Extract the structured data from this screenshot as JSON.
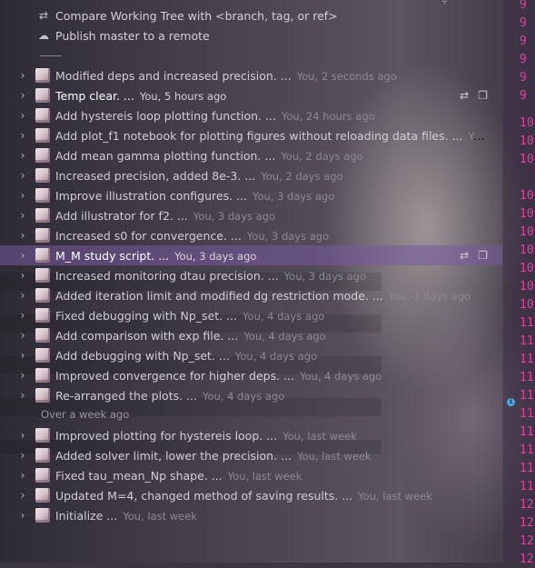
{
  "commands": [
    {
      "icon": "compare-icon",
      "glyph": "⇄",
      "label": "Compare Working Tree with <branch, tag, or ref>"
    },
    {
      "icon": "cloud-upload-icon",
      "glyph": "☁",
      "label": "Publish master to a remote"
    }
  ],
  "commits": [
    {
      "message": "Modified deps and increased precision. ...",
      "meta": "You, 2 seconds ago"
    },
    {
      "message": "Temp clear. ...",
      "meta": "You, 5 hours ago"
    },
    {
      "message": "Add hystereis loop plotting function. ...",
      "meta": "You, 24 hours ago"
    },
    {
      "message": "Add plot_f1 notebook for plotting figures without reloading data files. ...",
      "meta": "You, yest..."
    },
    {
      "message": "Add mean gamma plotting function. ...",
      "meta": "You, 2 days ago"
    },
    {
      "message": "Increased precision, added 8e-3. ...",
      "meta": "You, 2 days ago"
    },
    {
      "message": "Improve illustration configures. ...",
      "meta": "You, 3 days ago"
    },
    {
      "message": "Add illustrator for f2. ...",
      "meta": "You, 3 days ago"
    },
    {
      "message": "Increased s0 for convergence. ...",
      "meta": "You, 3 days ago"
    },
    {
      "message": "M_M study script. ...",
      "meta": "You, 3 days ago"
    },
    {
      "message": "Increased monitoring dtau precision. ...",
      "meta": "You, 3 days ago"
    },
    {
      "message": "Added iteration limit and modified dg restriction mode. ...",
      "meta": "You, 3 days ago"
    },
    {
      "message": "Fixed debugging with Np_set. ...",
      "meta": "You, 4 days ago"
    },
    {
      "message": "Add comparison with exp file. ...",
      "meta": "You, 4 days ago"
    },
    {
      "message": "Add debugging with Np_set. ...",
      "meta": "You, 4 days ago"
    },
    {
      "message": "Improved convergence for higher deps. ...",
      "meta": "You, 4 days ago"
    },
    {
      "message": "Re-arranged the plots. ...",
      "meta": "You, 4 days ago"
    }
  ],
  "older_group_label": "Over a week ago",
  "older_commits": [
    {
      "message": "Improved plotting for hystereis loop. ...",
      "meta": "You, last week"
    },
    {
      "message": "Added solver limit, lower the precision. ...",
      "meta": "You, last week"
    },
    {
      "message": "Fixed tau_mean_Np shape. ...",
      "meta": "You, last week"
    },
    {
      "message": "Updated M=4, changed method of saving results. ...",
      "meta": "You, last week"
    },
    {
      "message": "Initialize ...",
      "meta": "You, last week"
    }
  ],
  "line_numbers": [
    "9",
    "9",
    "9",
    "9",
    "9",
    "9",
    "10",
    "10",
    "10",
    "10",
    "10",
    "10",
    "10",
    "10",
    "10",
    "10",
    "11",
    "11",
    "11",
    "11",
    "11",
    "11",
    "11",
    "11",
    "11",
    "11",
    "12",
    "12",
    "12",
    "12"
  ],
  "row_actions": [
    {
      "icon": "compare-with-head-icon",
      "glyph": "⇄"
    },
    {
      "icon": "copy-icon",
      "glyph": "❐"
    }
  ],
  "accent_colors": {
    "line_number": "#e040a0",
    "selection": "#6e5296",
    "info_marker": "#4aa8e8"
  }
}
